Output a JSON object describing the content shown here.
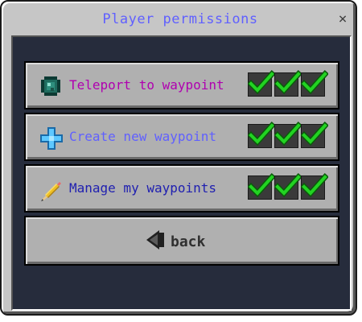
{
  "window": {
    "title": "Player permissions",
    "close_label": "×",
    "title_color": "#6060ff"
  },
  "permissions": [
    {
      "label": "Teleport to waypoint",
      "color": "#b000b0",
      "icon": "ender-pearl-icon",
      "checks": [
        true,
        true,
        true
      ]
    },
    {
      "label": "Create new waypoint",
      "color": "#6060ff",
      "icon": "plus-icon",
      "checks": [
        true,
        true,
        true
      ]
    },
    {
      "label": "Manage my waypoints",
      "color": "#2020b0",
      "icon": "pencil-icon",
      "checks": [
        true,
        true,
        true
      ]
    }
  ],
  "back": {
    "label": "back",
    "icon": "left-arrow-icon"
  }
}
